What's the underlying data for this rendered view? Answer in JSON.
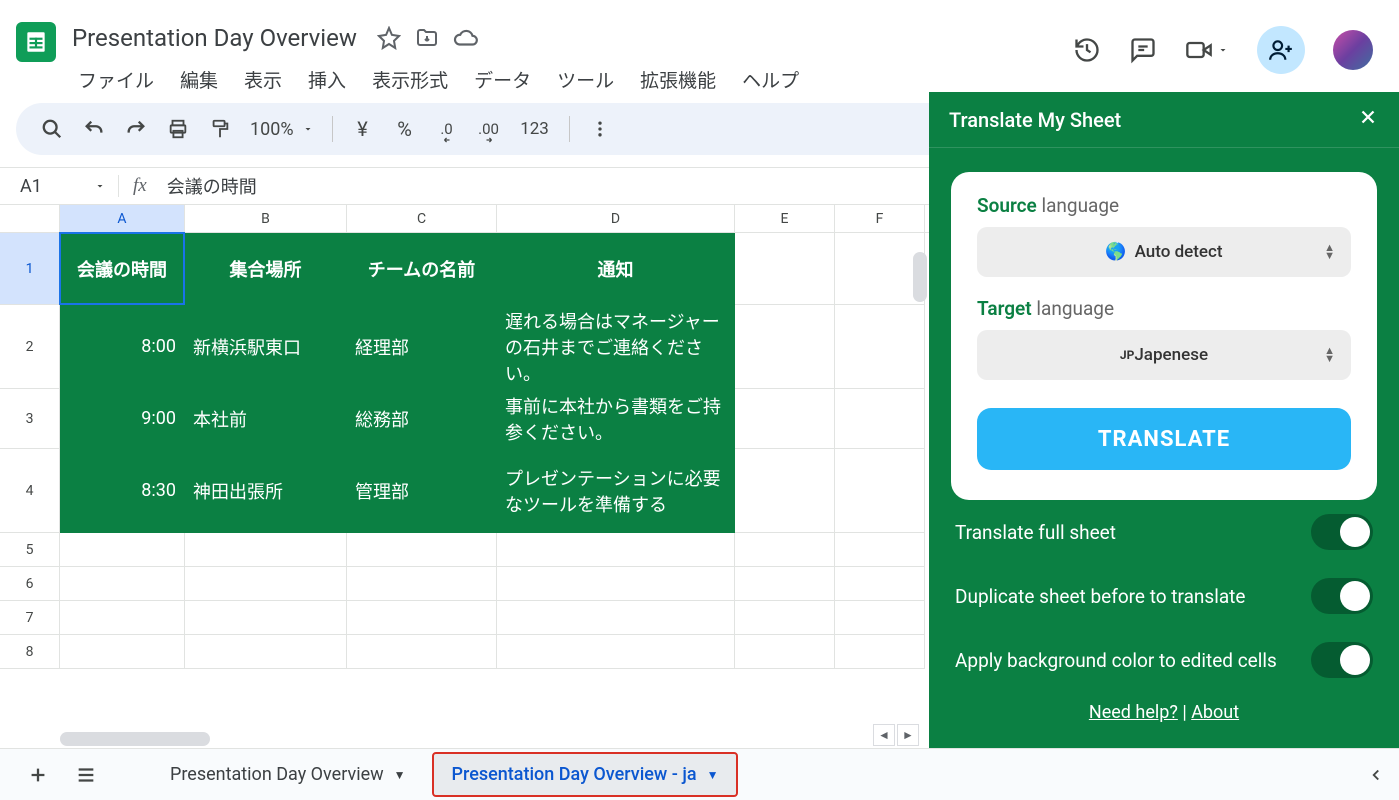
{
  "doc": {
    "title": "Presentation Day Overview"
  },
  "menus": [
    "ファイル",
    "編集",
    "表示",
    "挿入",
    "表示形式",
    "データ",
    "ツール",
    "拡張機能",
    "ヘルプ"
  ],
  "toolbar": {
    "zoom": "100%",
    "currency": "¥",
    "pct": "%",
    "dec_dec": ".0",
    "dec_inc": ".00",
    "num": "123"
  },
  "cellRef": "A1",
  "formula": "会議の時間",
  "columns": [
    "A",
    "B",
    "C",
    "D",
    "E",
    "F"
  ],
  "headerRow": [
    "会議の時間",
    "集合場所",
    "チームの名前",
    "通知"
  ],
  "dataRows": [
    {
      "time": "8:00",
      "place": "新横浜駅東口",
      "team": "経理部",
      "note": "遅れる場合はマネージャーの石井までご連絡ください。"
    },
    {
      "time": "9:00",
      "place": "本社前",
      "team": "総務部",
      "note": "事前に本社から書類をご持参ください。"
    },
    {
      "time": "8:30",
      "place": "神田出張所",
      "team": "管理部",
      "note": "プレゼンテーションに必要なツールを準備する"
    }
  ],
  "rowNums": [
    "1",
    "2",
    "3",
    "4",
    "5",
    "6",
    "7",
    "8"
  ],
  "panel": {
    "title": "Translate My Sheet",
    "sourceLbl1": "Source",
    "sourceLbl2": " language",
    "sourceVal": "Auto detect",
    "targetLbl1": "Target",
    "targetLbl2": " language",
    "targetPrefix": "JP",
    "targetVal": " Japenese",
    "btn": "TRANSLATE",
    "toggle1": "Translate full sheet",
    "toggle2": "Duplicate sheet before to translate",
    "toggle3": "Apply background color to edited cells",
    "help": "Need help?",
    "sep": " | ",
    "about": "About"
  },
  "tabs": {
    "t1": "Presentation Day Overview",
    "t2": "Presentation Day Overview - ja"
  }
}
